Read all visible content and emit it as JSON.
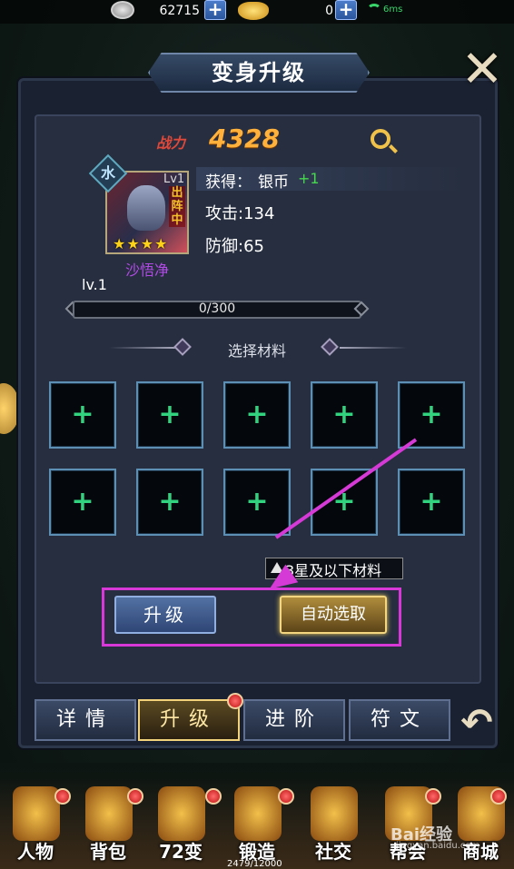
{
  "topbar": {
    "silver": "62715",
    "gold": "0",
    "ping": "6ms",
    "plus": "+"
  },
  "panel": {
    "title": "变身升级",
    "close": "✕"
  },
  "hero": {
    "power_label": "战力",
    "power_value": "4328",
    "element": "水",
    "level_tag": "Lv1",
    "deploy_tag": "出阵中",
    "stars": "★★★★",
    "star_count": 4,
    "name": "沙悟净",
    "reward_label": "获得：",
    "reward_item": "银币",
    "reward_amount": "+1",
    "attack": "攻击:134",
    "defense": "防御:65",
    "level": "lv.1",
    "exp_text": "0/300",
    "exp_progress": 0
  },
  "materials": {
    "title": "选择材料",
    "slot_symbol": "+",
    "filter_label": "3星及以下材料"
  },
  "actions": {
    "upgrade": "升级",
    "auto_select": "自动选取"
  },
  "tabs": [
    {
      "label": "详情"
    },
    {
      "label": "升级"
    },
    {
      "label": "进阶"
    },
    {
      "label": "符文"
    }
  ],
  "nav": [
    {
      "label": "人物"
    },
    {
      "label": "背包"
    },
    {
      "label": "72变"
    },
    {
      "label": "锻造"
    },
    {
      "label": "社交"
    },
    {
      "label": "帮会"
    },
    {
      "label": "商城"
    }
  ],
  "footer_exp": "2479/12000",
  "watermark": "Bai经验",
  "watermark_sub": "jingyan.baidu.com",
  "colors": {
    "accent_highlight": "#d938d9",
    "power": "#ffb13b",
    "plus_green": "#32d37f",
    "hero_name": "#b24be6"
  }
}
